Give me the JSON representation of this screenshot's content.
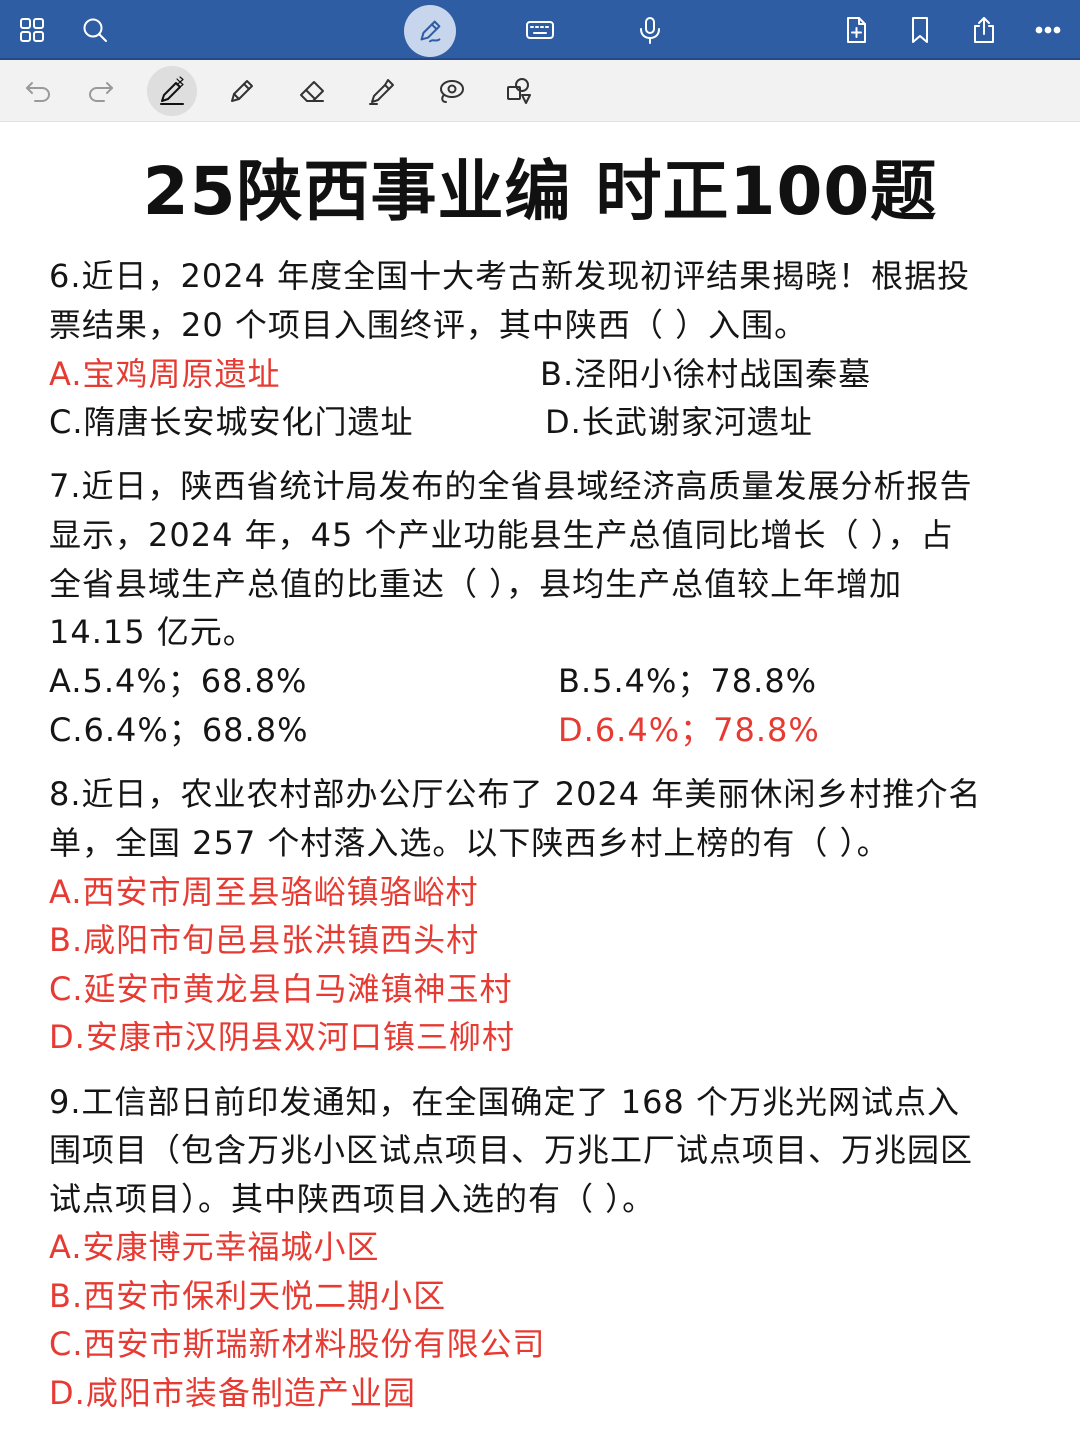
{
  "colors": {
    "topbar": "#2f5da3",
    "answer_red": "#e63a32",
    "toolbar_bg": "#f2f2f2"
  },
  "topbar": {
    "icons": [
      "grid-icon",
      "search-icon",
      "pen-mode-icon",
      "keyboard-icon",
      "microphone-icon",
      "add-page-icon",
      "bookmark-icon",
      "share-icon",
      "more-icon"
    ]
  },
  "toolbar2": {
    "icons": [
      "undo-icon",
      "redo-icon",
      "bluetooth-pen-icon",
      "pencil-icon",
      "eraser-icon",
      "highlighter-icon",
      "lasso-icon",
      "shapes-icon"
    ]
  },
  "document": {
    "title": "25陕西事业编 时正100题",
    "questions": [
      {
        "stem_lines": [
          "6.近日，2024 年度全国十大考古新发现初评结果揭晓！根据投",
          "票结果，20 个项目入围终评，其中陕西（ ）入围。"
        ],
        "options": [
          "A.宝鸡周原遗址",
          "B.泾阳小徐村战国秦墓",
          "C.隋唐长安城安化门遗址",
          "D.长武谢家河遗址"
        ]
      },
      {
        "stem_lines": [
          "7.近日，陕西省统计局发布的全省县域经济高质量发展分析报告",
          "显示，2024 年，45 个产业功能县生产总值同比增长（ ），占",
          "全省县域生产总值的比重达（ ），县均生产总值较上年增加",
          "14.15 亿元。"
        ],
        "options": [
          "A.5.4%；68.8%",
          "B.5.4%；78.8%",
          "C.6.4%；68.8%",
          "D.6.4%；78.8%"
        ]
      },
      {
        "stem_lines": [
          "8.近日，农业农村部办公厅公布了 2024 年美丽休闲乡村推介名",
          "单，全国 257 个村落入选。以下陕西乡村上榜的有（ ）。"
        ],
        "options": [
          "A.西安市周至县骆峪镇骆峪村",
          "B.咸阳市旬邑县张洪镇西头村",
          "C.延安市黄龙县白马滩镇神玉村",
          "D.安康市汉阴县双河口镇三柳村"
        ]
      },
      {
        "stem_lines": [
          "9.工信部日前印发通知，在全国确定了 168 个万兆光网试点入",
          "围项目（包含万兆小区试点项目、万兆工厂试点项目、万兆园区",
          "试点项目）。其中陕西项目入选的有（ ）。"
        ],
        "options": [
          "A.安康博元幸福城小区",
          "B.西安市保利天悦二期小区",
          "C.西安市斯瑞新材料股份有限公司",
          "D.咸阳市装备制造产业园"
        ]
      }
    ]
  }
}
